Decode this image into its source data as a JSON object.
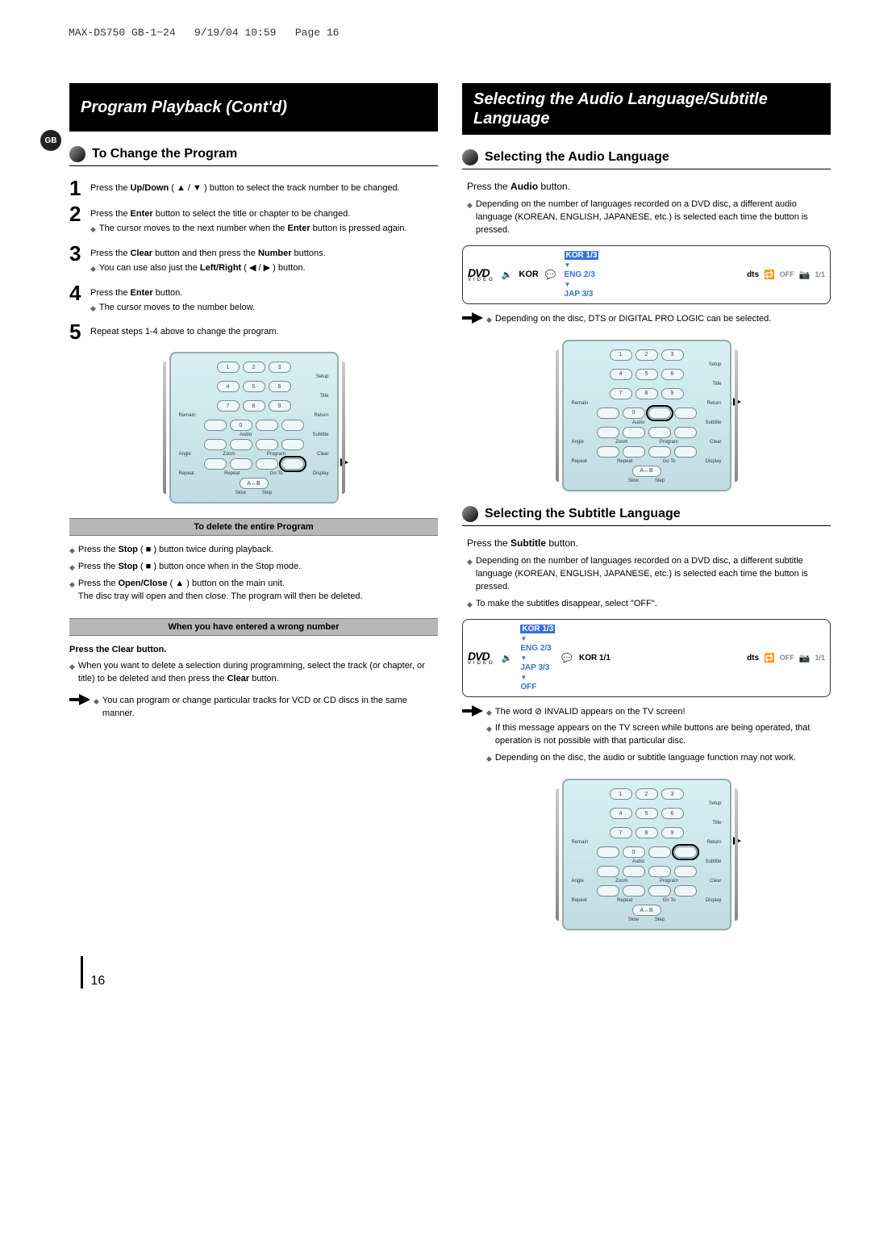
{
  "header": {
    "doc_id": "MAX-DS750 GB-1~24",
    "date": "9/19/04 10:59",
    "page_label": "Page 16"
  },
  "badge": "GB",
  "page_number": "16",
  "left": {
    "title": "Program Playback (Cont'd)",
    "subheading": "To Change the Program",
    "steps": {
      "1": {
        "main_a": "Press the ",
        "main_b": "Up/Down",
        "main_c": " ( ▲ / ▼ ) button to select the track number to be changed."
      },
      "2": {
        "main_a": "Press the ",
        "main_b": "Enter",
        "main_c": " button to select the title or chapter to be changed.",
        "sub_a": "The cursor moves to the next number when the ",
        "sub_b": "Enter",
        "sub_c": " button is pressed again."
      },
      "3": {
        "main_a": "Press the ",
        "main_b": "Clear",
        "main_c": " button and then press the ",
        "main_d": "Number",
        "main_e": " buttons.",
        "sub_a": "You can use also just the ",
        "sub_b": "Left/Right",
        "sub_c": " ( ◀ / ▶ ) button."
      },
      "4": {
        "main_a": "Press the ",
        "main_b": "Enter",
        "main_c": " button.",
        "sub_a": "The cursor moves to the number below."
      },
      "5": {
        "main": "Repeat steps 1-4 above to change the program."
      }
    },
    "grey1": "To delete the entire Program",
    "delete_bullets": {
      "b1_a": "Press the ",
      "b1_b": "Stop",
      "b1_c": " ( ■ ) button twice during playback.",
      "b2_a": "Press the ",
      "b2_b": "Stop",
      "b2_c": " ( ■ ) button once when in the Stop mode.",
      "b3_a": "Press the ",
      "b3_b": "Open/Close",
      "b3_c": " ( ▲ ) button on the main unit.",
      "b3_sub": "The disc tray will open and then close. The program will then be deleted."
    },
    "grey2": "When you have entered a wrong number",
    "wrong_heading": "Press the Clear button.",
    "wrong_text_a": "When you want to delete a selection during programming, select the track (or chapter, or title) to be deleted and then press the ",
    "wrong_text_b": "Clear",
    "wrong_text_c": " button.",
    "tip": "You can program or change particular tracks for VCD or CD discs in the same manner."
  },
  "right": {
    "title": "Selecting the Audio Language/Subtitle Language",
    "audio_heading": "Selecting the Audio Language",
    "audio_press_a": "Press the ",
    "audio_press_b": "Audio",
    "audio_press_c": " button.",
    "audio_note": "Depending on the number of languages recorded on a DVD disc, a different audio language (KOREAN, ENGLISH, JAPANESE, etc.) is selected each time the button is pressed.",
    "audio_tip": "Depending on the disc, DTS or DIGITAL PRO LOGIC can be selected.",
    "osd_audio": {
      "kor_label": "KOR",
      "sel": "KOR 1/3",
      "eng": "ENG 2/3",
      "jap": "JAP 3/3",
      "off": "OFF",
      "count": "1/1"
    },
    "sub_heading": "Selecting the Subtitle Language",
    "sub_press_a": "Press the ",
    "sub_press_b": "Subtitle",
    "sub_press_c": " button.",
    "sub_note1": "Depending on the number of languages recorded on a DVD disc, a different subtitle language (KOREAN, ENGLISH, JAPANESE, etc.) is selected each time the button is pressed.",
    "sub_note2": "To make the subtitles disappear, select \"OFF\".",
    "osd_sub": {
      "kor13": "KOR 1/3",
      "kor11": "KOR 1/1",
      "eng": "ENG 2/3",
      "jap": "JAP 3/3",
      "off_opt": "OFF",
      "off": "OFF",
      "count": "1/1"
    },
    "invalid_tip": "The word ⊘ INVALID appears on the TV screen!",
    "invalid_b1": "If this message appears on the TV screen while buttons are being operated, that operation is not possible with that particular disc.",
    "invalid_b2": "Depending on the disc, the audio or subtitle language function may not work."
  },
  "remote": {
    "labels_row1": {
      "a": "Setup",
      "b": "Title",
      "c": "Return"
    },
    "labels_row2": {
      "a": "Remain",
      "b": "Audio",
      "c": "Subtitle"
    },
    "labels_row3": {
      "a": "Angle",
      "b": "Zoom",
      "c": "Program",
      "d": "Clear"
    },
    "labels_row4": {
      "a": "Repeat",
      "b": "Repeat",
      "c": "Go To",
      "d": "Display"
    },
    "labels_row5": {
      "a": "Slow",
      "b": "Step"
    },
    "ab": "A↔B",
    "nums": [
      "1",
      "2",
      "3",
      "4",
      "5",
      "6",
      "7",
      "8",
      "9",
      "0"
    ]
  }
}
